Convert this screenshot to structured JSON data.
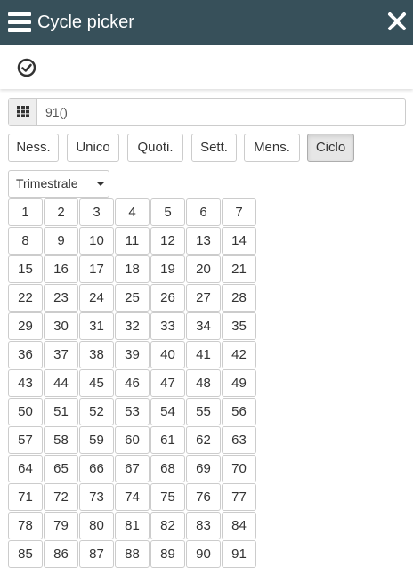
{
  "header": {
    "title": "Cycle picker",
    "menu_icon": "hamburger-menu-icon",
    "close_icon": "close-icon",
    "background": "#37505a"
  },
  "toolbar": {
    "confirm_icon": "check-circle-icon"
  },
  "value_field": {
    "addon_icon": "grid-icon",
    "value": "91()"
  },
  "type_buttons": [
    {
      "label": "Ness.",
      "active": false
    },
    {
      "label": "Unico",
      "active": false
    },
    {
      "label": "Quoti.",
      "active": false
    },
    {
      "label": "Sett.",
      "active": false
    },
    {
      "label": "Mens.",
      "active": false
    },
    {
      "label": "Ciclo",
      "active": true
    }
  ],
  "frequency": {
    "selected": "Trimestrale"
  },
  "days": [
    "1",
    "2",
    "3",
    "4",
    "5",
    "6",
    "7",
    "8",
    "9",
    "10",
    "11",
    "12",
    "13",
    "14",
    "15",
    "16",
    "17",
    "18",
    "19",
    "20",
    "21",
    "22",
    "23",
    "24",
    "25",
    "26",
    "27",
    "28",
    "29",
    "30",
    "31",
    "32",
    "33",
    "34",
    "35",
    "36",
    "37",
    "38",
    "39",
    "40",
    "41",
    "42",
    "43",
    "44",
    "45",
    "46",
    "47",
    "48",
    "49",
    "50",
    "51",
    "52",
    "53",
    "54",
    "55",
    "56",
    "57",
    "58",
    "59",
    "60",
    "61",
    "62",
    "63",
    "64",
    "65",
    "66",
    "67",
    "68",
    "69",
    "70",
    "71",
    "72",
    "73",
    "74",
    "75",
    "76",
    "77",
    "78",
    "79",
    "80",
    "81",
    "82",
    "83",
    "84",
    "85",
    "86",
    "87",
    "88",
    "89",
    "90",
    "91"
  ]
}
